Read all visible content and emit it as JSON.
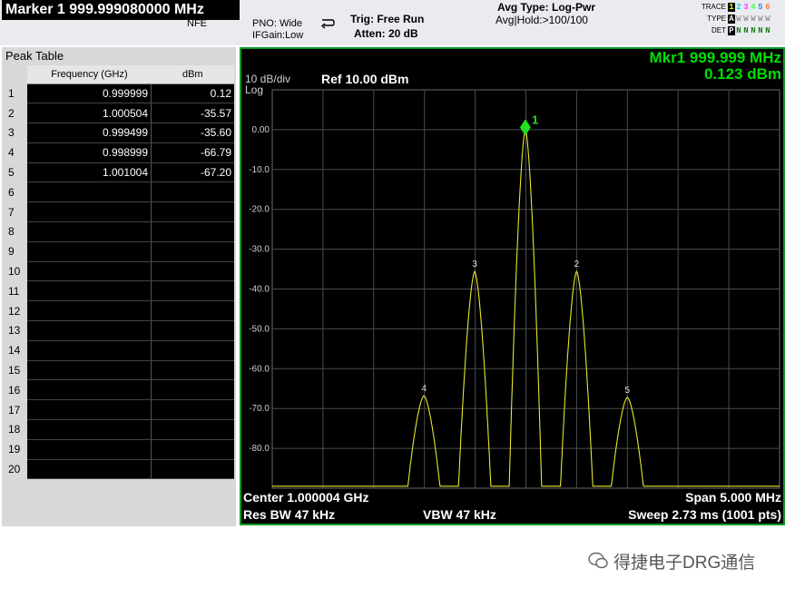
{
  "header": {
    "marker_title": "Marker 1 999.999080000 MHz",
    "nfe": "NFE",
    "pno": "PNO: Wide",
    "ifgain": "IFGain:Low",
    "trig": "Trig: Free Run",
    "atten": "Atten: 20 dB",
    "avg_type": "Avg Type: Log-Pwr",
    "avg_hold": "Avg|Hold:>100/100",
    "trace_label": "TRACE",
    "type_label": "TYPE",
    "det_label": "DET",
    "trace_numbers": [
      "1",
      "2",
      "3",
      "4",
      "5",
      "6"
    ],
    "trace_colors": [
      "#f0f000",
      "#00d0ff",
      "#ff40ff",
      "#40ff40",
      "#4080ff",
      "#ff8040"
    ],
    "type_chars": "AWWWWW",
    "det_chars": "PNNNNN"
  },
  "peak_table": {
    "title": "Peak Table",
    "col_freq": "Frequency (GHz)",
    "col_amp": "dBm",
    "rows": [
      {
        "n": "1",
        "freq": "0.999999",
        "amp": "0.12"
      },
      {
        "n": "2",
        "freq": "1.000504",
        "amp": "-35.57"
      },
      {
        "n": "3",
        "freq": "0.999499",
        "amp": "-35.60"
      },
      {
        "n": "4",
        "freq": "0.998999",
        "amp": "-66.79"
      },
      {
        "n": "5",
        "freq": "1.001004",
        "amp": "-67.20"
      },
      {
        "n": "6",
        "freq": "",
        "amp": ""
      },
      {
        "n": "7",
        "freq": "",
        "amp": ""
      },
      {
        "n": "8",
        "freq": "",
        "amp": ""
      },
      {
        "n": "9",
        "freq": "",
        "amp": ""
      },
      {
        "n": "10",
        "freq": "",
        "amp": ""
      },
      {
        "n": "11",
        "freq": "",
        "amp": ""
      },
      {
        "n": "12",
        "freq": "",
        "amp": ""
      },
      {
        "n": "13",
        "freq": "",
        "amp": ""
      },
      {
        "n": "14",
        "freq": "",
        "amp": ""
      },
      {
        "n": "15",
        "freq": "",
        "amp": ""
      },
      {
        "n": "16",
        "freq": "",
        "amp": ""
      },
      {
        "n": "17",
        "freq": "",
        "amp": ""
      },
      {
        "n": "18",
        "freq": "",
        "amp": ""
      },
      {
        "n": "19",
        "freq": "",
        "amp": ""
      },
      {
        "n": "20",
        "freq": "",
        "amp": ""
      }
    ]
  },
  "screen": {
    "scale": "10 dB/div",
    "log": "Log",
    "ref": "Ref 10.00 dBm",
    "mkr_line1": "Mkr1 999.999 MHz",
    "mkr_line2": "0.123 dBm",
    "y_ticks": [
      "0.00",
      "-10.0",
      "-20.0",
      "-30.0",
      "-40.0",
      "-50.0",
      "-60.0",
      "-70.0",
      "-80.0"
    ],
    "center": "Center 1.000004 GHz",
    "span": "Span 5.000 MHz",
    "rbw": "Res BW 47 kHz",
    "vbw": "VBW 47 kHz",
    "sweep": "Sweep  2.73 ms (1001 pts)",
    "trace_color": "#e6e62e",
    "marker_color": "#20e020"
  },
  "chart_data": {
    "type": "line",
    "x_center_ghz": 1.000004,
    "x_span_mhz": 5.0,
    "ylim": [
      -90,
      10
    ],
    "grid": true,
    "peaks": [
      {
        "marker": "1",
        "freq_ghz": 0.999999,
        "dbm": 0.12
      },
      {
        "marker": "2",
        "freq_ghz": 1.000504,
        "dbm": -35.57
      },
      {
        "marker": "3",
        "freq_ghz": 0.999499,
        "dbm": -35.6
      },
      {
        "marker": "4",
        "freq_ghz": 0.998999,
        "dbm": -66.79
      },
      {
        "marker": "5",
        "freq_ghz": 1.001004,
        "dbm": -67.2
      }
    ]
  },
  "watermark": "得捷电子DRG通信"
}
